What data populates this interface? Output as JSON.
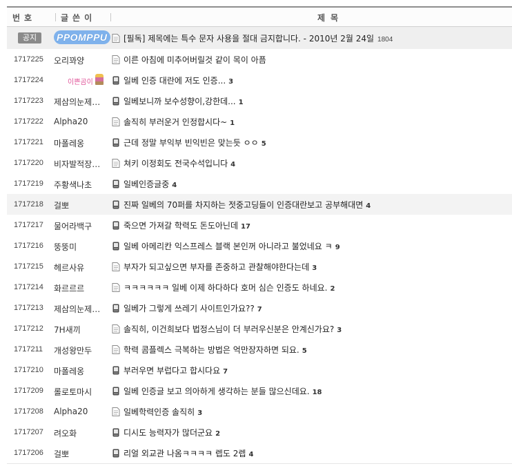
{
  "header": {
    "no": "번호",
    "writer": "글쓴이",
    "title": "제목"
  },
  "notice": {
    "badge": "공지",
    "writer_logo": "PPOMPPU",
    "title": "[필독] 제목에는 특수 문자 사용을 절대 금지합니다. - 2010년 2월 24일",
    "hits": "1804"
  },
  "posts": [
    {
      "no": "1717225",
      "writer": "오리꽈양",
      "icon": "document",
      "title": "이른 아침에 미추어버릴것 같이 목이 아픔",
      "comments": ""
    },
    {
      "no": "1717224",
      "writer": "이쁜곰이",
      "writer_is_image": true,
      "icon": "mobile",
      "title": "일베 인증 대란에 저도 인증...",
      "comments": "3"
    },
    {
      "no": "1717223",
      "writer": "제삼의눈제…",
      "icon": "mobile",
      "title": "일베보니까 보수성향이,강한데...",
      "comments": "1"
    },
    {
      "no": "1717222",
      "writer": "Alpha20",
      "icon": "document",
      "title": "솔직히 부러운거 인정합시다~",
      "comments": "1"
    },
    {
      "no": "1717221",
      "writer": "마폴레옹",
      "icon": "mobile",
      "title": "근데 정말 부익부 빈익빈은 맞는듯 ㅇㅇ",
      "comments": "5"
    },
    {
      "no": "1717220",
      "writer": "비자발적장…",
      "icon": "document",
      "title": "쳐키 이정회도 전국수석입니다",
      "comments": "4"
    },
    {
      "no": "1717219",
      "writer": "주황색나초",
      "icon": "mobile",
      "title": "일베인증글중",
      "comments": "4"
    },
    {
      "no": "1717218",
      "writer": "걸뽀",
      "icon": "mobile",
      "title": "진짜 일베의 70퍼를 차지하는 젓중고딩들이 인증대란보고 공부해대면",
      "comments": "4",
      "highlight": true
    },
    {
      "no": "1717217",
      "writer": "물어라백구",
      "icon": "mobile",
      "title": "죽으면 가져갈 학력도 돈도아닌데",
      "comments": "17"
    },
    {
      "no": "1717216",
      "writer": "뚱뚱미",
      "icon": "mobile",
      "title": "일베 아메리칸 익스프레스 블랙 본인꺼 아니라고 불었네요 ㅋ",
      "comments": "9"
    },
    {
      "no": "1717215",
      "writer": "헤르사유",
      "icon": "document",
      "title": "부자가 되고싶으면 부자를 존중하고 관찰해야한다는데",
      "comments": "3"
    },
    {
      "no": "1717214",
      "writer": "화르르르",
      "icon": "document",
      "title": "ㅋㅋㅋㅋㅋㅋ 일베 이제 하다하다 호머 심슨 인증도 하네요.",
      "comments": "2"
    },
    {
      "no": "1717213",
      "writer": "제삼의눈제…",
      "icon": "mobile",
      "title": "일베가 그렇게 쓰레기 사이트인가요??",
      "comments": "7"
    },
    {
      "no": "1717212",
      "writer": "7H새끼",
      "icon": "document",
      "title": "솔직히, 이건희보다 법정스님이 더 부러우신분은 안계신가요?",
      "comments": "3"
    },
    {
      "no": "1717211",
      "writer": "개성왕만두",
      "icon": "document",
      "title": "학력 콤플렉스 극복하는 방법은 억만장자하면 되요.",
      "comments": "5"
    },
    {
      "no": "1717210",
      "writer": "마폴레옹",
      "icon": "mobile",
      "title": "부러우면 부럽다고 합시다요",
      "comments": "7"
    },
    {
      "no": "1717209",
      "writer": "롤로토마시",
      "icon": "mobile",
      "title": "일베 인증글 보고 의아하게 생각하는 분들 많으신데요.",
      "comments": "18"
    },
    {
      "no": "1717208",
      "writer": "Alpha20",
      "icon": "document",
      "title": "일베학력인증 솔직히",
      "comments": "3"
    },
    {
      "no": "1717207",
      "writer": "려오화",
      "icon": "mobile",
      "title": "디시도 능력자가 많더군요",
      "comments": "2"
    },
    {
      "no": "1717206",
      "writer": "걸뽀",
      "icon": "mobile",
      "title": "리얼 외교관 나옴ㅋㅋㅋㅋ 렙도 2렙",
      "comments": "4"
    }
  ]
}
